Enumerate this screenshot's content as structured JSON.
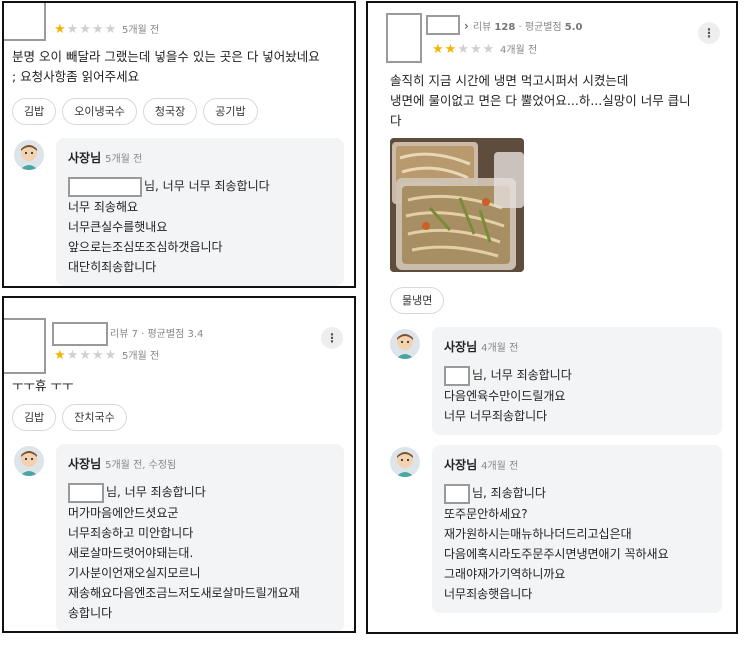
{
  "panel1": {
    "date": "5개월 전",
    "rating": 1,
    "review": [
      "분명 오이 빼달라 그랬는데 넣을수 있는 곳은 다 넣어놨네요",
      "; 요청사항좀 읽어주세요"
    ],
    "tags": [
      "김밥",
      "오이냉국수",
      "청국장",
      "공기밥"
    ],
    "reply": {
      "owner": "사장님",
      "date": "5개월 전",
      "first_line": "님, 너무 너무 죄송합니다",
      "lines": [
        "너무 죄송해요",
        "너무큰실수를햇내요",
        "앞으로는조심또조심하갯읍니다",
        "대단히죄송합니다"
      ]
    }
  },
  "panel2": {
    "meta": "리뷰 7 · 평균별점 3.4",
    "date": "5개월 전",
    "rating": 1,
    "review": [
      "ㅜㅜ휴 ㅜㅜ"
    ],
    "tags": [
      "김밥",
      "잔치국수"
    ],
    "reply": {
      "owner": "사장님",
      "date": "5개월 전, 수정됨",
      "first_line": "님, 너무 죄송합니다",
      "lines": [
        "머가마음에안드셧요군",
        "너무죄송하고 미안합니다",
        "새로살마드렷어야돼는대.",
        "기사분이언재오실지모르니",
        "재송해요다음엔조금느저도새로살마드릴개요재",
        "송합니다"
      ]
    }
  },
  "panel3": {
    "meta_reviews_label": "리뷰 ",
    "meta_reviews_count": "128",
    "meta_sep": " · 평균별점 ",
    "meta_avg": "5.0",
    "date": "4개월 전",
    "rating": 2,
    "review": [
      "솔직히 지금 시간에 냉면 먹고시퍼서 시켰는데",
      "냉면에 물이없고 면은 다 뿔었어요...하...실망이 너무 큽니",
      "다"
    ],
    "tags": [
      "물냉면"
    ],
    "reply1": {
      "owner": "사장님",
      "date": "4개월 전",
      "first_line": "님, 너무 죄송합니다",
      "lines": [
        "다음엔육수만이드릴개요",
        "너무 너무죄송합니다"
      ]
    },
    "reply2": {
      "owner": "사장님",
      "date": "4개월 전",
      "first_line": "님, 죄송합니다",
      "lines": [
        "또주문안하세요?",
        "재가원하시는매뉴하나더드리고십은대",
        "다음에혹시라도주문주시면냉면애기 꼭하새요",
        "그래야재가기역하니까요",
        "너무죄송햇읍니다"
      ]
    }
  },
  "icons": {
    "more": "more-vertical-icon",
    "chevron": "chevron-right-icon",
    "star": "star-icon",
    "avatar": "owner-avatar-icon"
  },
  "colors": {
    "star_on": "#f5b400",
    "star_off": "#d0d0d0",
    "reply_bg": "#f3f4f6"
  }
}
